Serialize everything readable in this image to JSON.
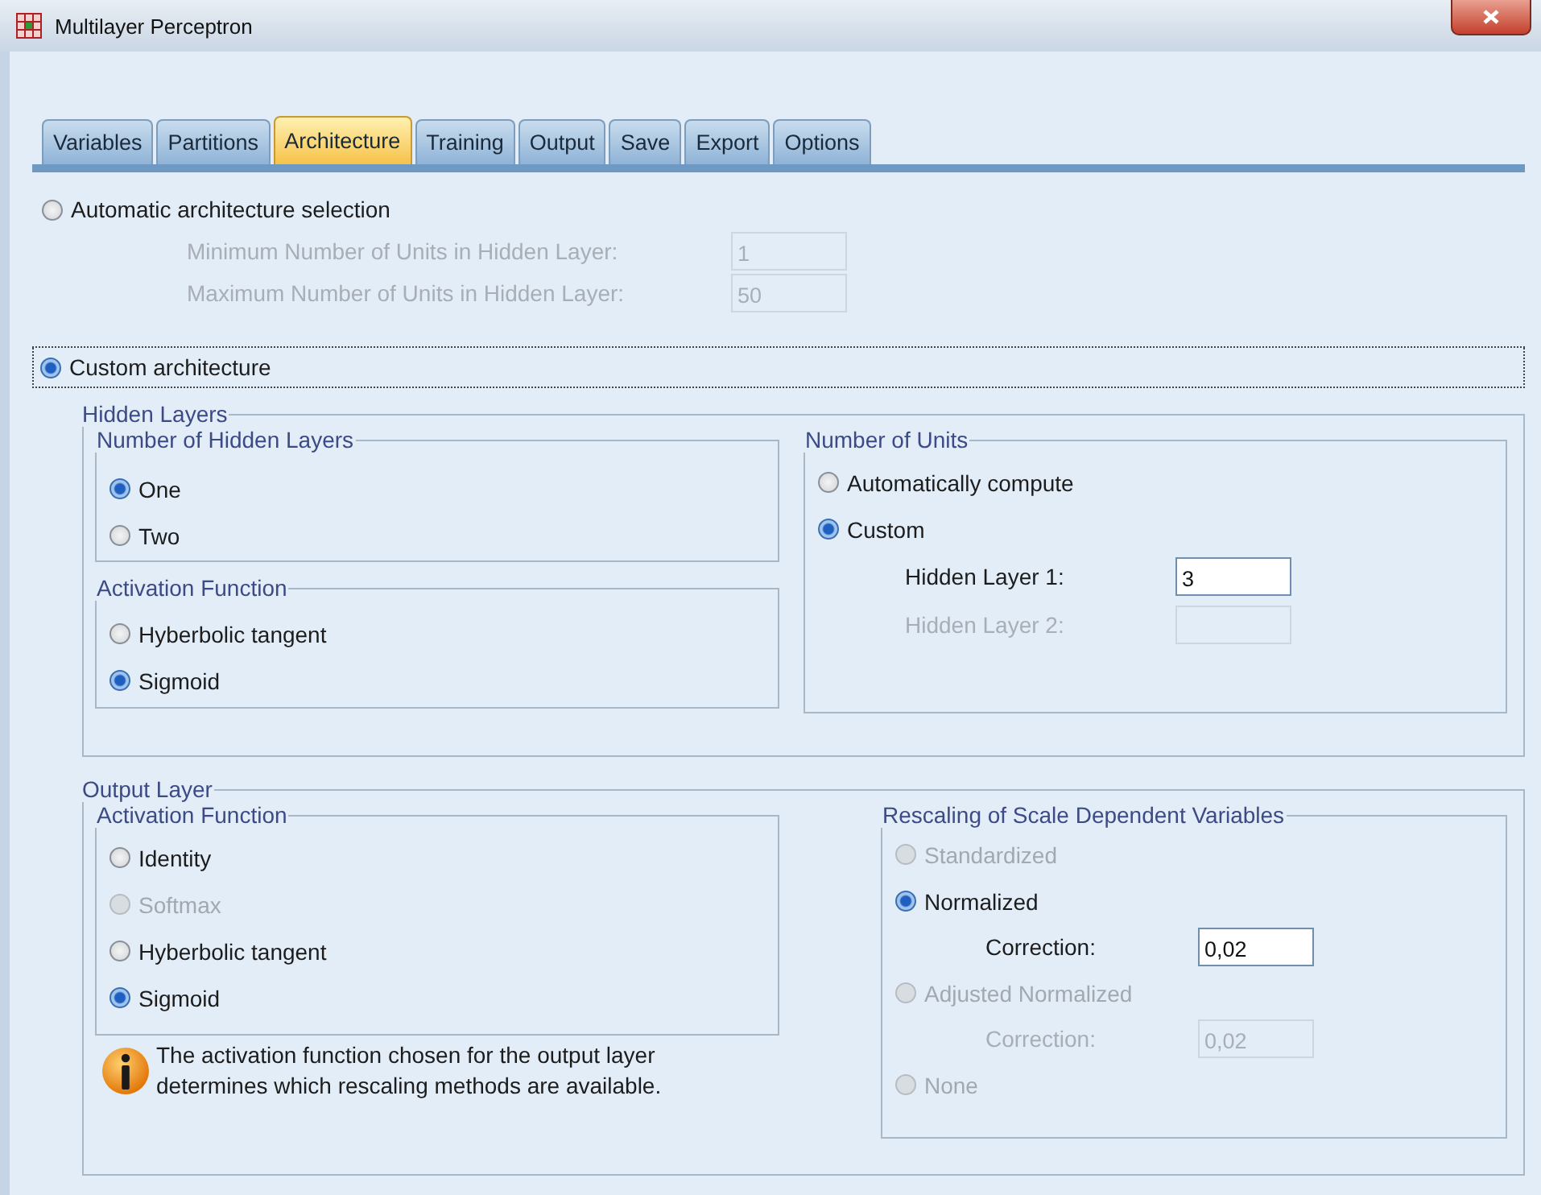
{
  "window": {
    "title": "Multilayer Perceptron"
  },
  "tabs": [
    {
      "label": "Variables",
      "selected": false
    },
    {
      "label": "Partitions",
      "selected": false
    },
    {
      "label": "Architecture",
      "selected": true
    },
    {
      "label": "Training",
      "selected": false
    },
    {
      "label": "Output",
      "selected": false
    },
    {
      "label": "Save",
      "selected": false
    },
    {
      "label": "Export",
      "selected": false
    },
    {
      "label": "Options",
      "selected": false
    }
  ],
  "automatic": {
    "label": "Automatic architecture selection",
    "selected": false,
    "fields": [
      {
        "label": "Minimum Number of Units in Hidden Layer:",
        "value": "1",
        "disabled": true
      },
      {
        "label": "Maximum Number of Units in Hidden Layer:",
        "value": "50",
        "disabled": true
      }
    ]
  },
  "custom": {
    "label": "Custom architecture",
    "selected": true
  },
  "hidden_layers": {
    "title": "Hidden Layers",
    "number_of_hidden_layers": {
      "title": "Number of Hidden Layers",
      "options": [
        {
          "label": "One",
          "selected": true,
          "disabled": false
        },
        {
          "label": "Two",
          "selected": false,
          "disabled": false
        }
      ]
    },
    "activation_function": {
      "title": "Activation Function",
      "options": [
        {
          "label": "Hyberbolic tangent",
          "selected": false,
          "disabled": false
        },
        {
          "label": "Sigmoid",
          "selected": true,
          "disabled": false
        }
      ]
    },
    "number_of_units": {
      "title": "Number of Units",
      "options": [
        {
          "label": "Automatically compute",
          "selected": false,
          "disabled": false
        },
        {
          "label": "Custom",
          "selected": true,
          "disabled": false
        }
      ],
      "fields": [
        {
          "label": "Hidden Layer 1:",
          "value": "3",
          "disabled": false
        },
        {
          "label": "Hidden Layer 2:",
          "disabled": true
        }
      ]
    }
  },
  "output_layer": {
    "title": "Output Layer",
    "activation_function": {
      "title": "Activation Function",
      "options": [
        {
          "label": "Identity",
          "selected": false,
          "disabled": false
        },
        {
          "label": "Softmax",
          "selected": false,
          "disabled": true
        },
        {
          "label": "Hyberbolic tangent",
          "selected": false,
          "disabled": false
        },
        {
          "label": "Sigmoid",
          "selected": true,
          "disabled": false
        }
      ]
    },
    "note": "The activation function chosen for the output layer\ndetermines which rescaling methods are available.",
    "rescaling": {
      "title": "Rescaling of Scale Dependent Variables",
      "items": [
        {
          "kind": "radio",
          "label": "Standardized",
          "selected": false,
          "disabled": true
        },
        {
          "kind": "radio",
          "label": "Normalized",
          "selected": true,
          "disabled": false
        },
        {
          "kind": "field",
          "label": "Correction:",
          "value": "0,02",
          "disabled": false
        },
        {
          "kind": "radio",
          "label": "Adjusted Normalized",
          "selected": false,
          "disabled": true
        },
        {
          "kind": "field",
          "label": "Correction:",
          "value": "0,02",
          "disabled": true
        },
        {
          "kind": "radio",
          "label": "None",
          "selected": false,
          "disabled": true
        }
      ]
    }
  }
}
